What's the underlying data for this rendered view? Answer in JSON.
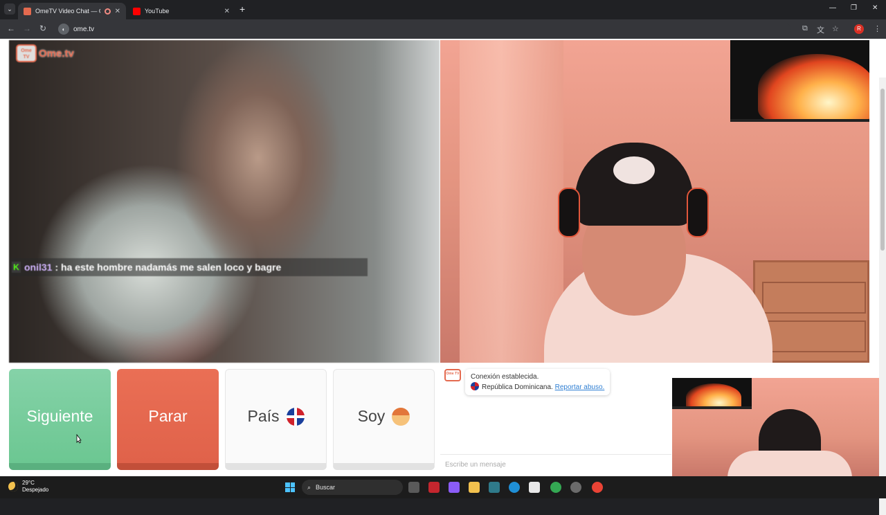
{
  "browser": {
    "tabs": [
      {
        "title": "OmeTV Video Chat — Ome",
        "active": true
      },
      {
        "title": "YouTube",
        "active": false
      }
    ],
    "url": "ome.tv"
  },
  "page": {
    "logo_text": "Ome.tv",
    "logo_box_text": "Ome TV",
    "chat_overlay": {
      "badge": "K",
      "user": "onil31",
      "message": ": ha este hombre nadamás me salen loco y bagre"
    },
    "buttons": {
      "next": "Siguiente",
      "stop": "Parar",
      "country": "País",
      "gender": "Soy"
    },
    "system_message": {
      "line1": "Conexión establecida.",
      "country": "República Dominicana.",
      "report_link": "Reportar abuso."
    },
    "message_placeholder": "Escribe un mensaje"
  },
  "taskbar": {
    "temperature": "29°C",
    "condition": "Despejado",
    "search_label": "Buscar"
  },
  "colors": {
    "next_button": "#6cc792",
    "stop_button": "#e0624a",
    "brand": "#e46a4f"
  }
}
